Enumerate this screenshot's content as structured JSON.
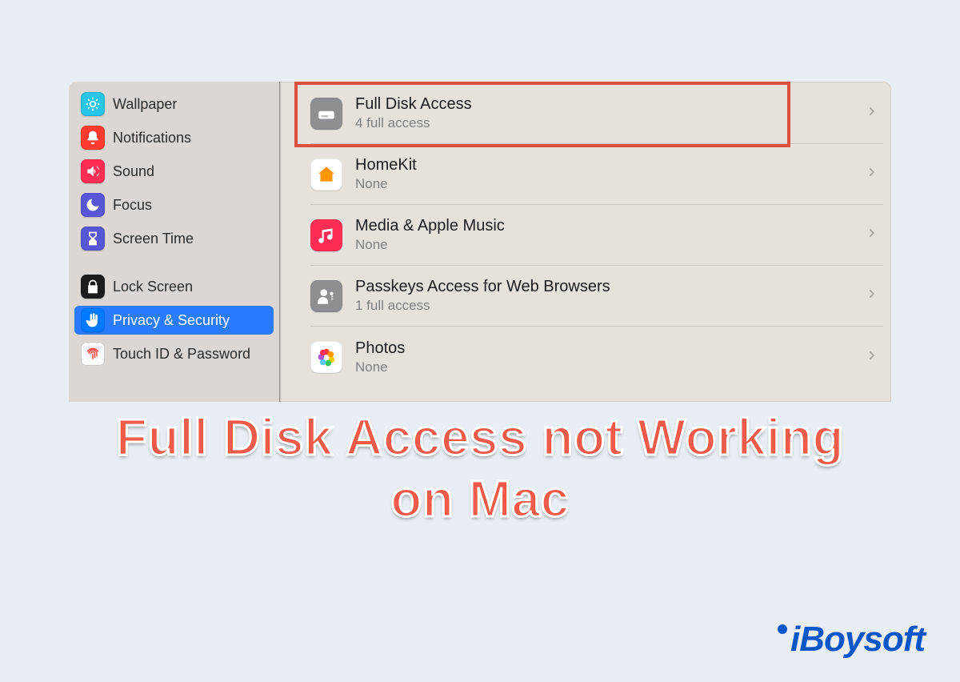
{
  "sidebar": {
    "items": [
      {
        "label": "Wallpaper"
      },
      {
        "label": "Notifications"
      },
      {
        "label": "Sound"
      },
      {
        "label": "Focus"
      },
      {
        "label": "Screen Time"
      },
      {
        "label": "Lock Screen"
      },
      {
        "label": "Privacy & Security"
      },
      {
        "label": "Touch ID & Password"
      }
    ]
  },
  "panel": {
    "rows": [
      {
        "title": "Full Disk Access",
        "sub": "4 full access"
      },
      {
        "title": "HomeKit",
        "sub": "None"
      },
      {
        "title": "Media & Apple Music",
        "sub": "None"
      },
      {
        "title": "Passkeys Access for Web Browsers",
        "sub": "1 full access"
      },
      {
        "title": "Photos",
        "sub": "None"
      }
    ]
  },
  "caption": {
    "line1": "Full Disk Access not Working",
    "line2": "on Mac"
  },
  "watermark": "iBoysoft"
}
